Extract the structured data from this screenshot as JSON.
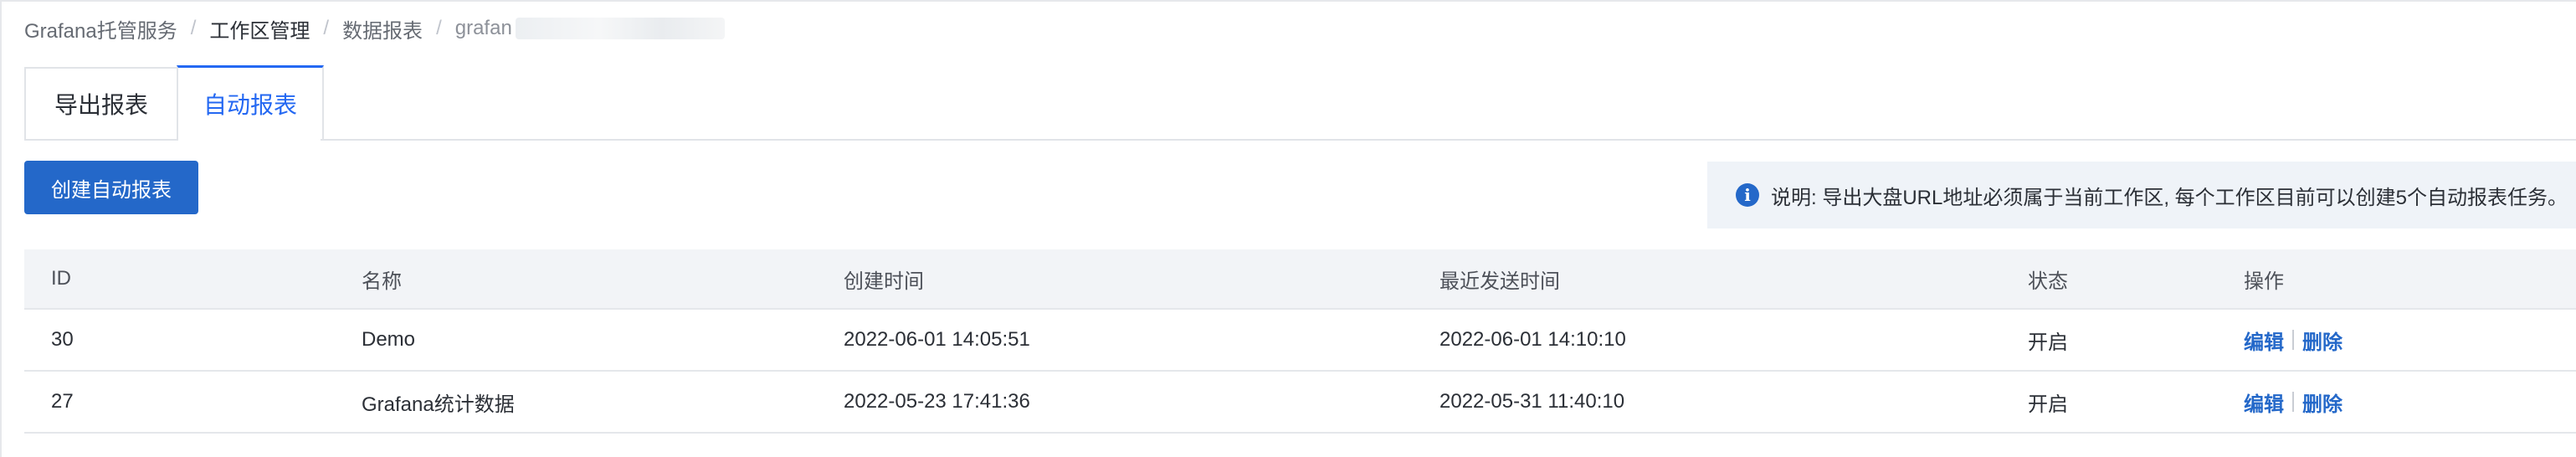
{
  "breadcrumb": {
    "items": [
      "Grafana托管服务",
      "工作区管理",
      "数据报表"
    ],
    "last": "grafan",
    "separator": "/"
  },
  "tabs": [
    {
      "label": "导出报表",
      "active": false
    },
    {
      "label": "自动报表",
      "active": true
    }
  ],
  "toolbar": {
    "create_label": "创建自动报表"
  },
  "notice": {
    "icon": "info-icon",
    "icon_glyph": "i",
    "text": "说明: 导出大盘URL地址必须属于当前工作区, 每个工作区目前可以创建5个自动报表任务。"
  },
  "table": {
    "columns": [
      "ID",
      "名称",
      "创建时间",
      "最近发送时间",
      "状态",
      "操作"
    ],
    "rows": [
      {
        "id": "30",
        "name": "Demo",
        "created": "2022-06-01 14:05:51",
        "last_sent": "2022-06-01 14:10:10",
        "status": "开启",
        "edit": "编辑",
        "delete": "删除"
      },
      {
        "id": "27",
        "name": "Grafana统计数据",
        "created": "2022-05-23 17:41:36",
        "last_sent": "2022-05-31 11:40:10",
        "status": "开启",
        "edit": "编辑",
        "delete": "删除"
      }
    ]
  },
  "colors": {
    "accent": "#2468c9",
    "tab_active": "#2468f2",
    "notice_bg": "#eff3f8",
    "header_bg": "#f2f4f7"
  }
}
